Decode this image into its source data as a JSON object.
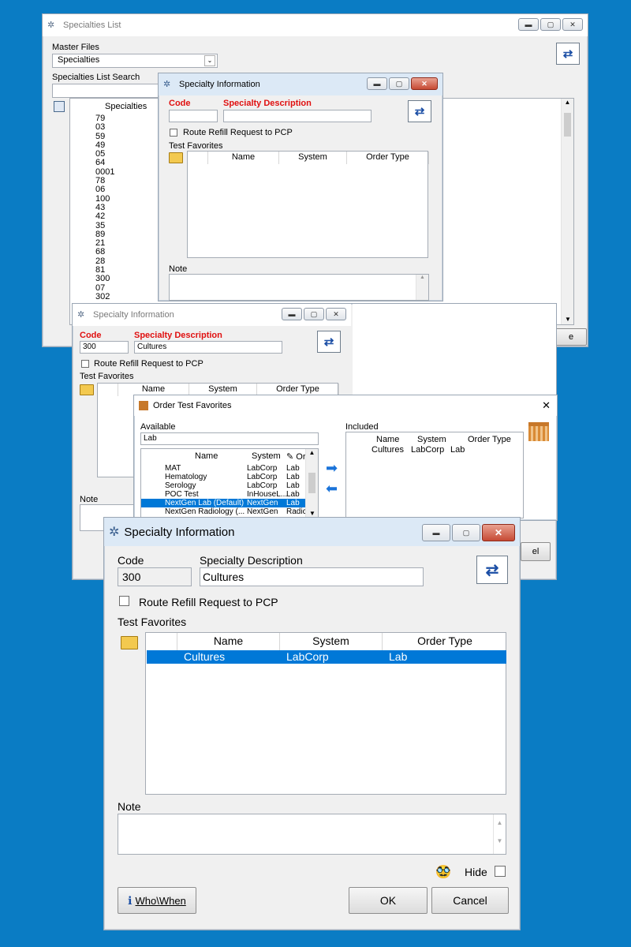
{
  "win1": {
    "title": "Specialties List",
    "master_files_label": "Master Files",
    "master_files_value": "Specialties",
    "search_label": "Specialties List Search",
    "list_header": "Specialties",
    "codes": [
      "79",
      "03",
      "59",
      "49",
      "05",
      "64",
      "0001",
      "78",
      "06",
      "100",
      "43",
      "42",
      "35",
      "89",
      "21",
      "68",
      "28",
      "81",
      "300",
      "07",
      "302"
    ],
    "partial_button": "e"
  },
  "win2": {
    "title": "Specialty Information",
    "code_label": "Code",
    "desc_label": "Specialty Description",
    "code_value": "",
    "desc_value": "",
    "route_label": "Route Refill Request to PCP",
    "test_favorites_label": "Test Favorites",
    "col_name": "Name",
    "col_system": "System",
    "col_order_type": "Order Type",
    "note_label": "Note"
  },
  "win3": {
    "title": "Specialty Information",
    "code_label": "Code",
    "desc_label": "Specialty Description",
    "code_value": "300",
    "desc_value": "Cultures",
    "route_label": "Route Refill Request to PCP",
    "test_favorites_label": "Test Favorites",
    "col_name": "Name",
    "col_system": "System",
    "col_order_type": "Order Type",
    "note_label": "Note",
    "partial_button": "el"
  },
  "win4": {
    "title": "Order Test Favorites",
    "close_glyph": "✕",
    "available_label": "Available",
    "search_value": "Lab",
    "included_label": "Included",
    "avail_cols": {
      "name": "Name",
      "system": "System",
      "order": "Or"
    },
    "available_rows": [
      {
        "name": "MAT",
        "system": "LabCorp",
        "type": "Lab"
      },
      {
        "name": "Hematology",
        "system": "LabCorp",
        "type": "Lab"
      },
      {
        "name": "Serology",
        "system": "LabCorp",
        "type": "Lab"
      },
      {
        "name": "POC Test",
        "system": "InHouseL...",
        "type": "Lab"
      },
      {
        "name": "NextGen Lab (Default)",
        "system": "NextGen",
        "type": "Lab"
      },
      {
        "name": "NextGen Radiology (...",
        "system": "NextGen",
        "type": "Radic"
      }
    ],
    "included_cols": {
      "name": "Name",
      "system": "System",
      "order_type": "Order Type"
    },
    "included_rows": [
      {
        "name": "Cultures",
        "system": "LabCorp",
        "type": "Lab"
      }
    ]
  },
  "win5": {
    "title": "Specialty Information",
    "code_label": "Code",
    "desc_label": "Specialty Description",
    "code_value": "300",
    "desc_value": "Cultures",
    "route_label": "Route Refill Request to PCP",
    "test_favorites_label": "Test Favorites",
    "col_name": "Name",
    "col_system": "System",
    "col_order_type": "Order Type",
    "rows": [
      {
        "name": "Cultures",
        "system": "LabCorp",
        "type": "Lab"
      }
    ],
    "note_label": "Note",
    "hide_label": "Hide",
    "who_when_label": "Who\\When",
    "ok_label": "OK",
    "cancel_label": "Cancel"
  },
  "colors": {
    "desktop": "#0a7cc4",
    "selection": "#0078d7",
    "required_label": "#e01010"
  }
}
